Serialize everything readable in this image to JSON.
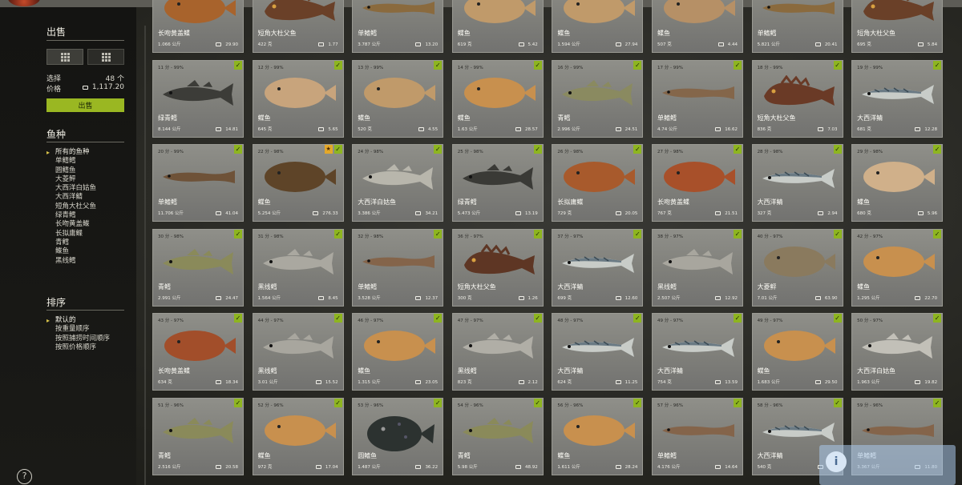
{
  "sidebar": {
    "sell_title": "出售",
    "select_label": "选择",
    "select_value": "48 个",
    "price_label": "价格",
    "price_value": "1,117.20",
    "sell_button": "出售",
    "species_title": "鱼种",
    "species": [
      "所有的鱼种",
      "单鳍鳕",
      "圆鳍鱼",
      "大菱鲆",
      "大西洋白姑鱼",
      "大西洋鲭",
      "短角大杜父鱼",
      "绿青鳕",
      "长吻黄盖鲽",
      "长拟庸鲽",
      "青鳕",
      "鲽鱼",
      "黑线鳕"
    ],
    "sort_title": "排序",
    "sort_options": [
      "默认的",
      "按重量顺序",
      "按照捕捞时间顺序",
      "按照价格顺序"
    ],
    "help_icon": "?"
  },
  "colors": {
    "accent": "#9ab722",
    "check": "#8eb520",
    "favorite": "#e4a82a"
  },
  "cards": [
    {
      "head": "",
      "name": "长吻黄盖鲽",
      "weight": "1.066 公斤",
      "price": "29.90",
      "fish": "flat",
      "color": "#a8632c"
    },
    {
      "head": "",
      "name": "短角大杜父鱼",
      "weight": "422 克",
      "price": "1.77",
      "fish": "sculpin",
      "color": "#6a4028"
    },
    {
      "head": "",
      "name": "单鳍鳕",
      "weight": "3.787 公斤",
      "price": "13.20",
      "fish": "eel",
      "color": "#8a6a3e"
    },
    {
      "head": "",
      "name": "鲽鱼",
      "weight": "619 克",
      "price": "5.42",
      "fish": "flat",
      "color": "#c09a6a"
    },
    {
      "head": "",
      "name": "鲽鱼",
      "weight": "1.594 公斤",
      "price": "27.94",
      "fish": "flat",
      "color": "#c09a6a"
    },
    {
      "head": "",
      "name": "鲽鱼",
      "weight": "507 克",
      "price": "4.44",
      "fish": "flat",
      "color": "#b69066"
    },
    {
      "head": "",
      "name": "单鳍鳕",
      "weight": "5.821 公斤",
      "price": "20.41",
      "fish": "eel",
      "color": "#8a6a3e"
    },
    {
      "head": "",
      "name": "短角大杜父鱼",
      "weight": "695 克",
      "price": "5.84",
      "fish": "sculpin",
      "color": "#6a4028"
    },
    {
      "head": "11 分 - 99%",
      "name": "绿青鳕",
      "weight": "8.144 公斤",
      "price": "14.81",
      "fish": "round",
      "color": "#3c3c38"
    },
    {
      "head": "12 分 - 99%",
      "name": "鲽鱼",
      "weight": "645 克",
      "price": "5.65",
      "fish": "flat",
      "color": "#c8a47c"
    },
    {
      "head": "13 分 - 99%",
      "name": "鲽鱼",
      "weight": "520 克",
      "price": "4.55",
      "fish": "flat",
      "color": "#c09a6a"
    },
    {
      "head": "14 分 - 99%",
      "name": "鲽鱼",
      "weight": "1.63 公斤",
      "price": "28.57",
      "fish": "flat",
      "color": "#c8904e"
    },
    {
      "head": "16 分 - 99%",
      "name": "青鳕",
      "weight": "2.996 公斤",
      "price": "24.51",
      "fish": "round",
      "color": "#8a8a60"
    },
    {
      "head": "17 分 - 99%",
      "name": "单鳍鳕",
      "weight": "4.74 公斤",
      "price": "16.62",
      "fish": "eel",
      "color": "#84664a"
    },
    {
      "head": "18 分 - 99%",
      "name": "短角大杜父鱼",
      "weight": "836 克",
      "price": "7.03",
      "fish": "sculpin",
      "color": "#6a3a26"
    },
    {
      "head": "19 分 - 99%",
      "name": "大西洋鲭",
      "weight": "681 克",
      "price": "12.28",
      "fish": "mackerel",
      "color": "#6a7a84"
    },
    {
      "head": "20 分 - 99%",
      "name": "单鳍鳕",
      "weight": "11.706 公斤",
      "price": "41.04",
      "fish": "eel",
      "color": "#6e5238"
    },
    {
      "head": "22 分 - 98%",
      "name": "鲽鱼",
      "weight": "5.254 公斤",
      "price": "276.33",
      "fish": "flat",
      "color": "#5e4428",
      "fav": true
    },
    {
      "head": "24 分 - 98%",
      "name": "大西洋白姑鱼",
      "weight": "3.386 公斤",
      "price": "34.21",
      "fish": "round",
      "color": "#b8b6ac"
    },
    {
      "head": "25 分 - 98%",
      "name": "绿青鳕",
      "weight": "5.473 公斤",
      "price": "13.19",
      "fish": "round",
      "color": "#3a3a36"
    },
    {
      "head": "26 分 - 98%",
      "name": "长拟庸鲽",
      "weight": "729 克",
      "price": "20.05",
      "fish": "flat",
      "color": "#a85a2c"
    },
    {
      "head": "27 分 - 98%",
      "name": "长吻黄盖鲽",
      "weight": "767 克",
      "price": "21.51",
      "fish": "flat",
      "color": "#a8502a"
    },
    {
      "head": "28 分 - 98%",
      "name": "大西洋鲭",
      "weight": "327 克",
      "price": "2.94",
      "fish": "mackerel",
      "color": "#6a7a84"
    },
    {
      "head": "29 分 - 98%",
      "name": "鲽鱼",
      "weight": "680 克",
      "price": "5.96",
      "fish": "flat",
      "color": "#d0b08a"
    },
    {
      "head": "30 分 - 98%",
      "name": "青鳕",
      "weight": "2.991 公斤",
      "price": "24.47",
      "fish": "round",
      "color": "#8a8a5a"
    },
    {
      "head": "31 分 - 98%",
      "name": "黑线鳕",
      "weight": "1.564 公斤",
      "price": "8.45",
      "fish": "round",
      "color": "#aaa8a0"
    },
    {
      "head": "32 分 - 98%",
      "name": "单鳍鳕",
      "weight": "3.528 公斤",
      "price": "12.37",
      "fish": "eel",
      "color": "#84644a"
    },
    {
      "head": "36 分 - 97%",
      "name": "短角大杜父鱼",
      "weight": "300 克",
      "price": "1.26",
      "fish": "sculpin",
      "color": "#5e3624"
    },
    {
      "head": "37 分 - 97%",
      "name": "大西洋鲭",
      "weight": "699 克",
      "price": "12.60",
      "fish": "mackerel",
      "color": "#6a7a84"
    },
    {
      "head": "38 分 - 97%",
      "name": "黑线鳕",
      "weight": "2.507 公斤",
      "price": "12.92",
      "fish": "round",
      "color": "#a8a69e"
    },
    {
      "head": "40 分 - 97%",
      "name": "大菱鲆",
      "weight": "7.01 公斤",
      "price": "63.90",
      "fish": "flat",
      "color": "#8a7a5e"
    },
    {
      "head": "42 分 - 97%",
      "name": "鲽鱼",
      "weight": "1.295 公斤",
      "price": "22.70",
      "fish": "flat",
      "color": "#c8904e"
    },
    {
      "head": "43 分 - 97%",
      "name": "长吻黄盖鲽",
      "weight": "634 克",
      "price": "18.34",
      "fish": "flat",
      "color": "#a24e2a"
    },
    {
      "head": "44 分 - 97%",
      "name": "黑线鳕",
      "weight": "3.01 公斤",
      "price": "15.52",
      "fish": "round",
      "color": "#a8a69e"
    },
    {
      "head": "46 分 - 97%",
      "name": "鲽鱼",
      "weight": "1.315 公斤",
      "price": "23.05",
      "fish": "flat",
      "color": "#c8904e"
    },
    {
      "head": "47 分 - 97%",
      "name": "黑线鳕",
      "weight": "823 克",
      "price": "2.12",
      "fish": "round",
      "color": "#b0aea6"
    },
    {
      "head": "48 分 - 97%",
      "name": "大西洋鲭",
      "weight": "624 克",
      "price": "11.25",
      "fish": "mackerel",
      "color": "#6a7a84"
    },
    {
      "head": "49 分 - 97%",
      "name": "大西洋鲭",
      "weight": "754 克",
      "price": "13.59",
      "fish": "mackerel",
      "color": "#6a7a84"
    },
    {
      "head": "49 分 - 97%",
      "name": "鲽鱼",
      "weight": "1.683 公斤",
      "price": "29.50",
      "fish": "flat",
      "color": "#c8904e"
    },
    {
      "head": "50 分 - 97%",
      "name": "大西洋白姑鱼",
      "weight": "1.963 公斤",
      "price": "19.82",
      "fish": "round",
      "color": "#c2c0b8"
    },
    {
      "head": "51 分 - 96%",
      "name": "青鳕",
      "weight": "2.516 公斤",
      "price": "20.58",
      "fish": "round",
      "color": "#8a8a5a"
    },
    {
      "head": "52 分 - 96%",
      "name": "鲽鱼",
      "weight": "972 克",
      "price": "17.04",
      "fish": "flat",
      "color": "#c8904e"
    },
    {
      "head": "53 分 - 96%",
      "name": "圆鳍鱼",
      "weight": "1.487 公斤",
      "price": "36.22",
      "fish": "lump",
      "color": "#2c3230"
    },
    {
      "head": "54 分 - 96%",
      "name": "青鳕",
      "weight": "5.98 公斤",
      "price": "48.92",
      "fish": "round",
      "color": "#8a8a5a"
    },
    {
      "head": "56 分 - 96%",
      "name": "鲽鱼",
      "weight": "1.611 公斤",
      "price": "28.24",
      "fish": "flat",
      "color": "#c8904e"
    },
    {
      "head": "57 分 - 96%",
      "name": "单鳍鳕",
      "weight": "4.176 公斤",
      "price": "14.64",
      "fish": "eel",
      "color": "#84644a"
    },
    {
      "head": "58 分 - 96%",
      "name": "大西洋鲭",
      "weight": "540 克",
      "price": "9.73",
      "fish": "mackerel",
      "color": "#6a7a84"
    },
    {
      "head": "59 分 - 96%",
      "name": "单鳍鳕",
      "weight": "3.367 公斤",
      "price": "11.80",
      "fish": "eel",
      "color": "#84644a"
    }
  ]
}
